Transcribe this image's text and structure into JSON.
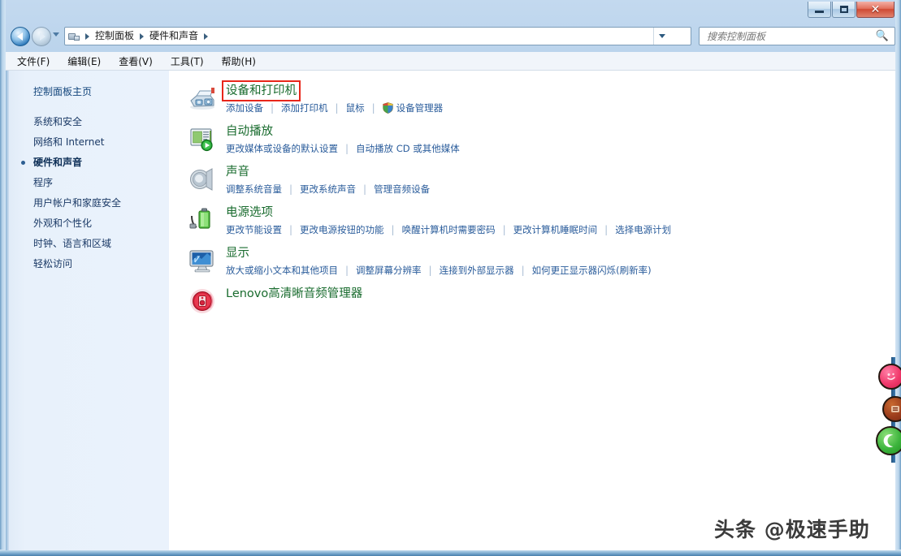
{
  "window": {
    "buttons": {
      "minimize": "—",
      "maximize": "▢",
      "close": "✕"
    }
  },
  "nav": {
    "back_tooltip": "后退",
    "forward_tooltip": "前进",
    "breadcrumb": [
      "控制面板",
      "硬件和声音"
    ],
    "refresh_glyph": "⟳"
  },
  "search": {
    "placeholder": "搜索控制面板",
    "value": "",
    "icon": "search-icon"
  },
  "menubar": {
    "items": [
      {
        "label": "文件(F)"
      },
      {
        "label": "编辑(E)"
      },
      {
        "label": "查看(V)"
      },
      {
        "label": "工具(T)"
      },
      {
        "label": "帮助(H)"
      }
    ]
  },
  "sidebar": {
    "home_label": "控制面板主页",
    "items": [
      {
        "label": "系统和安全",
        "active": false
      },
      {
        "label": "网络和 Internet",
        "active": false
      },
      {
        "label": "硬件和声音",
        "active": true
      },
      {
        "label": "程序",
        "active": false
      },
      {
        "label": "用户帐户和家庭安全",
        "active": false
      },
      {
        "label": "外观和个性化",
        "active": false
      },
      {
        "label": "时钟、语言和区域",
        "active": false
      },
      {
        "label": "轻松访问",
        "active": false
      }
    ]
  },
  "content": {
    "categories": [
      {
        "title": "设备和打印机",
        "icon": "devices-and-printers-icon",
        "highlighted": true,
        "links": [
          {
            "label": "添加设备",
            "shield": false
          },
          {
            "label": "添加打印机",
            "shield": false
          },
          {
            "label": "鼠标",
            "shield": false
          },
          {
            "label": "设备管理器",
            "shield": true
          }
        ]
      },
      {
        "title": "自动播放",
        "icon": "autoplay-icon",
        "highlighted": false,
        "links": [
          {
            "label": "更改媒体或设备的默认设置",
            "shield": false
          },
          {
            "label": "自动播放 CD 或其他媒体",
            "shield": false
          }
        ]
      },
      {
        "title": "声音",
        "icon": "sound-icon",
        "highlighted": false,
        "links": [
          {
            "label": "调整系统音量",
            "shield": false
          },
          {
            "label": "更改系统声音",
            "shield": false
          },
          {
            "label": "管理音频设备",
            "shield": false
          }
        ]
      },
      {
        "title": "电源选项",
        "icon": "power-options-icon",
        "highlighted": false,
        "links": [
          {
            "label": "更改节能设置",
            "shield": false
          },
          {
            "label": "更改电源按钮的功能",
            "shield": false
          },
          {
            "label": "唤醒计算机时需要密码",
            "shield": false
          },
          {
            "label": "更改计算机睡眠时间",
            "shield": false
          },
          {
            "label": "选择电源计划",
            "shield": false
          }
        ]
      },
      {
        "title": "显示",
        "icon": "display-icon",
        "highlighted": false,
        "links": [
          {
            "label": "放大或缩小文本和其他项目",
            "shield": false
          },
          {
            "label": "调整屏幕分辨率",
            "shield": false
          },
          {
            "label": "连接到外部显示器",
            "shield": false
          },
          {
            "label": "如何更正显示器闪烁(刷新率)",
            "shield": false
          }
        ]
      },
      {
        "title": "Lenovo高清晰音频管理器",
        "icon": "lenovo-audio-manager-icon",
        "highlighted": false,
        "links": []
      }
    ],
    "link_separator": "|"
  },
  "floating_widgets": [
    {
      "name": "pink-face-widget",
      "glyph": "",
      "color": "#f0396b"
    },
    {
      "name": "brown-badge-widget",
      "glyph": "",
      "color": "#9c3d1c"
    },
    {
      "name": "green-moon-widget",
      "glyph": "",
      "color": "#3cb43c"
    }
  ],
  "watermark": {
    "text": "头条 @极速手助"
  },
  "colors": {
    "category_title": "#1a6c2f",
    "link": "#2a5c9b",
    "highlight_border": "#e8261a",
    "sidebar_bg": "#eaf2fc",
    "sidebar_text": "#1b3a66"
  }
}
